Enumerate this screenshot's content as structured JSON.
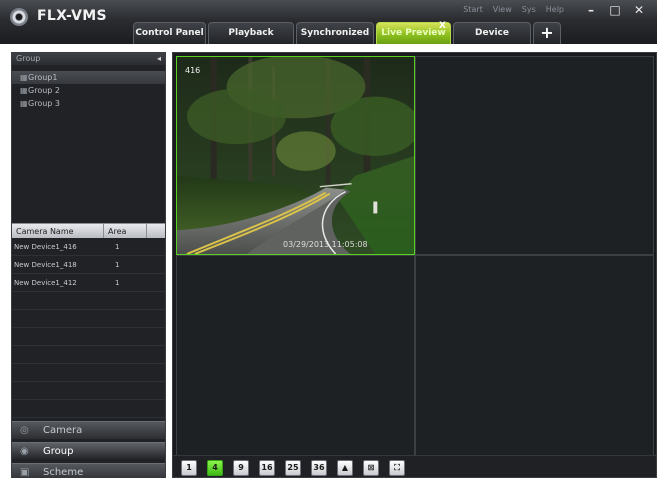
{
  "app": {
    "title": "FLX-VMS"
  },
  "sysmenu": [
    "Start",
    "View",
    "Sys",
    "Help"
  ],
  "window_controls": [
    {
      "name": "minimize",
      "glyph": "–"
    },
    {
      "name": "maximize",
      "glyph": "□"
    },
    {
      "name": "close",
      "glyph": "✕"
    }
  ],
  "tabs": [
    {
      "label": "Control Panel"
    },
    {
      "label": "Playback"
    },
    {
      "label": "Synchronized"
    },
    {
      "label": "Live Preview",
      "active": true,
      "close": "X"
    },
    {
      "label": "Device"
    },
    {
      "label": "+"
    }
  ],
  "sidebar": {
    "group_header": "Group",
    "collapse_glyph": "◂",
    "groups": [
      {
        "label": "Group1",
        "selected": true
      },
      {
        "label": "Group 2"
      },
      {
        "label": "Group 3"
      }
    ],
    "camera_table": {
      "columns": [
        "Camera Name",
        "Area"
      ],
      "rows": [
        {
          "name": "New Device1_416",
          "area": "1"
        },
        {
          "name": "New Device1_418",
          "area": "1"
        },
        {
          "name": "New Device1_412",
          "area": "1"
        }
      ]
    },
    "nav": [
      {
        "label": "Camera"
      },
      {
        "label": "Group",
        "active": true
      },
      {
        "label": "Scheme"
      }
    ]
  },
  "main": {
    "cells": [
      {
        "label": "416",
        "timestamp": "03/29/2013 11:05:08",
        "selected": true,
        "has_video": true
      },
      {
        "label": "",
        "selected": false,
        "has_video": false
      },
      {
        "label": "",
        "selected": false,
        "has_video": false
      },
      {
        "label": "",
        "selected": false,
        "has_video": false
      }
    ],
    "toolbar": [
      {
        "label": "1",
        "active": false
      },
      {
        "label": "4",
        "active": true
      },
      {
        "label": "9",
        "active": false
      },
      {
        "label": "16",
        "active": false
      },
      {
        "label": "25",
        "active": false
      },
      {
        "label": "36",
        "active": false
      },
      {
        "label": "▲",
        "active": false
      },
      {
        "label": "⊠",
        "active": false
      },
      {
        "label": "⛶",
        "active": false
      }
    ]
  }
}
